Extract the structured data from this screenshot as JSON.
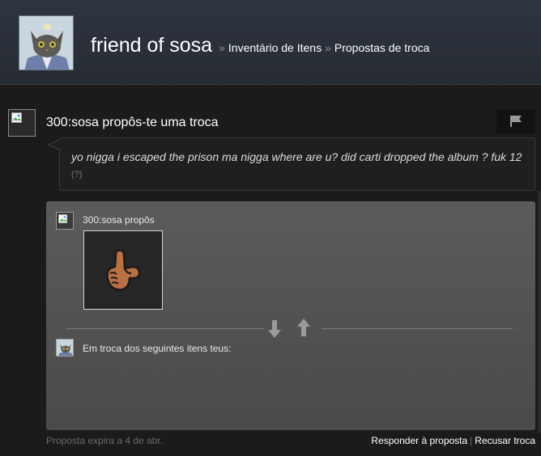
{
  "header": {
    "profile_name": "friend of sosa",
    "separator": "»",
    "breadcrumb_inventory": "Inventário de Itens",
    "breadcrumb_offers": "Propostas de troca"
  },
  "offer": {
    "heading": "300:sosa propôs-te uma troca",
    "message": "yo nigga i escaped the prison ma nigga where are u? did carti dropped the album ? fuk 12",
    "help": "(?)"
  },
  "trade": {
    "them_label": "300:sosa propôs",
    "you_label": "Em troca dos seguintes itens teus:",
    "item_icon": "pointing-hand-icon"
  },
  "footer": {
    "expiry": "Proposta expira a 4 de abr.",
    "respond_label": "Responder à proposta",
    "divider": "|",
    "decline_label": "Recusar troca"
  },
  "colors": {
    "header_bg": "#2f3540",
    "page_bg": "#1b1b1b",
    "trade_box_bg": "#555555",
    "accent_text": "#ffffff"
  }
}
